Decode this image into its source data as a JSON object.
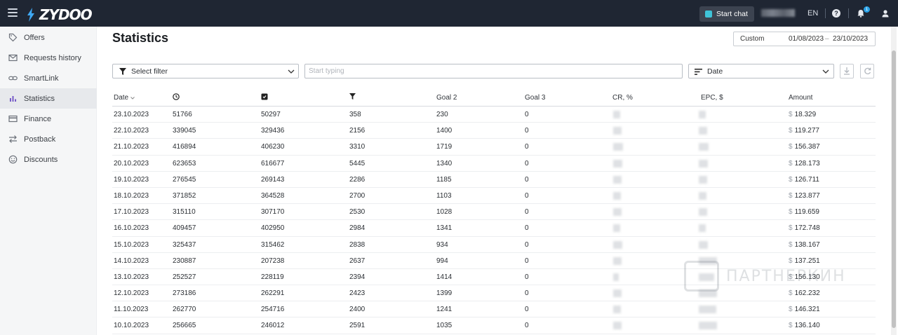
{
  "app": {
    "brand": "ZYDOO",
    "start_chat": "Start chat",
    "language": "EN",
    "help_glyph": "?",
    "notification_count": "1"
  },
  "sidebar": {
    "items": [
      {
        "label": "Offers",
        "icon": "tag-icon"
      },
      {
        "label": "Requests history",
        "icon": "mail-icon"
      },
      {
        "label": "SmartLink",
        "icon": "link-icon"
      },
      {
        "label": "Statistics",
        "icon": "bar-chart-icon",
        "active": true
      },
      {
        "label": "Finance",
        "icon": "card-icon"
      },
      {
        "label": "Postback",
        "icon": "arrows-icon"
      },
      {
        "label": "Discounts",
        "icon": "smile-icon"
      }
    ]
  },
  "page": {
    "title": "Statistics"
  },
  "date_range": {
    "preset": "Custom",
    "from": "01/08/2023",
    "separator": "–",
    "to": "23/10/2023"
  },
  "filters": {
    "select_filter": "Select filter",
    "search_placeholder": "Start typing",
    "sort_label": "Date"
  },
  "table": {
    "headers": {
      "date": "Date",
      "clicks_icon": "clock-icon",
      "unique_icon": "badge-icon",
      "goal1_icon": "funnel-icon",
      "goal2": "Goal 2",
      "goal3": "Goal 3",
      "cr": "CR, %",
      "epc": "EPC, $",
      "amount": "Amount"
    },
    "currency": "$",
    "rows": [
      {
        "date": "23.10.2023",
        "c1": "51766",
        "c2": "50297",
        "c3": "358",
        "goal2": "230",
        "goal3": "0",
        "amount": "18.329"
      },
      {
        "date": "22.10.2023",
        "c1": "339045",
        "c2": "329436",
        "c3": "2156",
        "goal2": "1400",
        "goal3": "0",
        "amount": "119.277"
      },
      {
        "date": "21.10.2023",
        "c1": "416894",
        "c2": "406230",
        "c3": "3310",
        "goal2": "1719",
        "goal3": "0",
        "amount": "156.387"
      },
      {
        "date": "20.10.2023",
        "c1": "623653",
        "c2": "616677",
        "c3": "5445",
        "goal2": "1340",
        "goal3": "0",
        "amount": "128.173"
      },
      {
        "date": "19.10.2023",
        "c1": "276545",
        "c2": "269143",
        "c3": "2286",
        "goal2": "1185",
        "goal3": "0",
        "amount": "126.711"
      },
      {
        "date": "18.10.2023",
        "c1": "371852",
        "c2": "364528",
        "c3": "2700",
        "goal2": "1103",
        "goal3": "0",
        "amount": "123.877"
      },
      {
        "date": "17.10.2023",
        "c1": "315110",
        "c2": "307170",
        "c3": "2530",
        "goal2": "1028",
        "goal3": "0",
        "amount": "119.659"
      },
      {
        "date": "16.10.2023",
        "c1": "409457",
        "c2": "402950",
        "c3": "2984",
        "goal2": "1341",
        "goal3": "0",
        "amount": "172.748"
      },
      {
        "date": "15.10.2023",
        "c1": "325437",
        "c2": "315462",
        "c3": "2838",
        "goal2": "934",
        "goal3": "0",
        "amount": "138.167"
      },
      {
        "date": "14.10.2023",
        "c1": "230887",
        "c2": "207238",
        "c3": "2637",
        "goal2": "994",
        "goal3": "0",
        "amount": "137.251"
      },
      {
        "date": "13.10.2023",
        "c1": "252527",
        "c2": "228119",
        "c3": "2394",
        "goal2": "1414",
        "goal3": "0",
        "amount": "156.130"
      },
      {
        "date": "12.10.2023",
        "c1": "273186",
        "c2": "262291",
        "c3": "2423",
        "goal2": "1399",
        "goal3": "0",
        "amount": "162.232"
      },
      {
        "date": "11.10.2023",
        "c1": "262770",
        "c2": "254716",
        "c3": "2400",
        "goal2": "1241",
        "goal3": "0",
        "amount": "146.321"
      },
      {
        "date": "10.10.2023",
        "c1": "256665",
        "c2": "246012",
        "c3": "2591",
        "goal2": "1035",
        "goal3": "0",
        "amount": "136.140"
      }
    ]
  },
  "watermark": {
    "text": "ПАРТНЕРКИН"
  },
  "colors": {
    "topbar": "#1f2633",
    "accent": "#3fc3d8",
    "badge": "#2aa3e8"
  }
}
